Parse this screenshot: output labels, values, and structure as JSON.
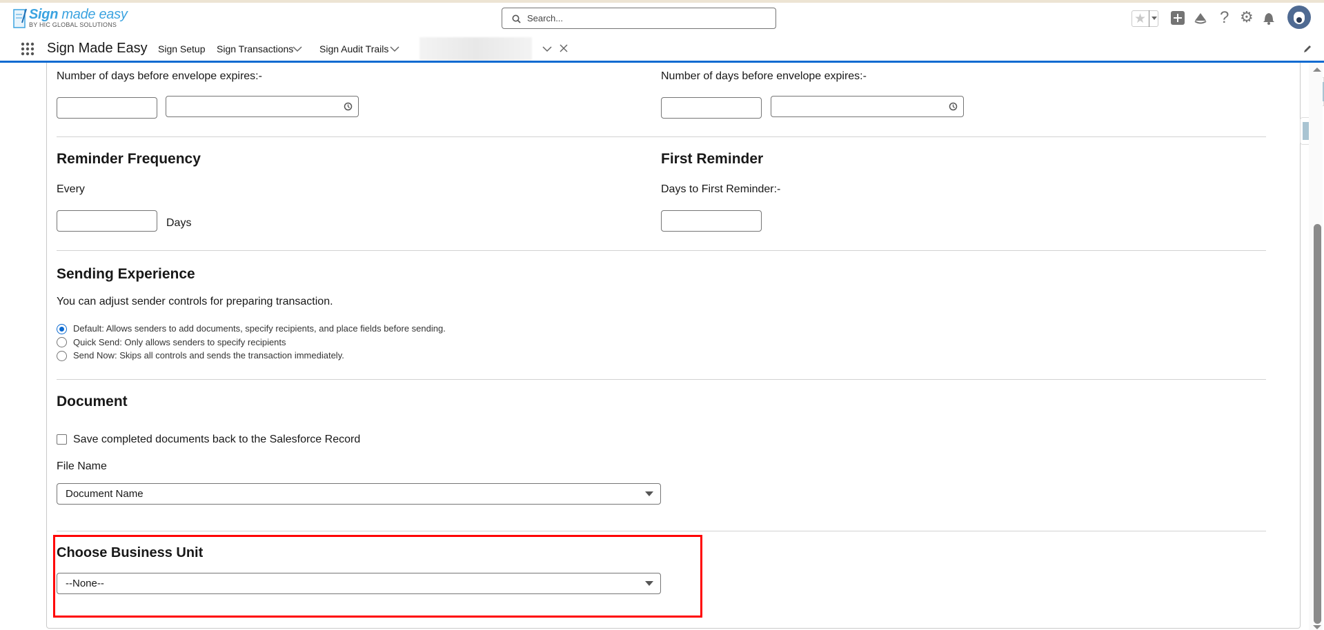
{
  "header": {
    "logo_title_bold": "Sign",
    "logo_title_rest": " made easy",
    "logo_subtitle": "BY HIC GLOBAL SOLUTIONS",
    "search_placeholder": "Search...",
    "icons": [
      "star-icon",
      "chevron-down-icon",
      "plus-icon",
      "trailhead-icon",
      "help-icon",
      "gear-icon",
      "bell-icon",
      "avatar"
    ]
  },
  "nav": {
    "app_name": "Sign Made Easy",
    "items": [
      {
        "label": "Sign Setup"
      },
      {
        "label": "Sign Transactions"
      },
      {
        "label": "Sign Audit Trails"
      }
    ]
  },
  "expiry": {
    "left_label": "Number of days before envelope expires:-",
    "right_label": "Number of days before envelope expires:-"
  },
  "reminder": {
    "heading": "Reminder Frequency",
    "every_label": "Every",
    "days_label": "Days"
  },
  "first_reminder": {
    "heading": "First Reminder",
    "label": "Days to First Reminder:-"
  },
  "sending": {
    "heading": "Sending Experience",
    "description": "You can adjust sender controls for preparing transaction.",
    "options": [
      {
        "label": "Default: Allows senders to add documents, specify recipients, and place fields before sending.",
        "selected": true
      },
      {
        "label": "Quick Send: Only allows senders to specify recipients",
        "selected": false
      },
      {
        "label": "Send Now: Skips all controls and sends the transaction immediately.",
        "selected": false
      }
    ]
  },
  "document": {
    "heading": "Document",
    "checkbox_label": "Save completed documents back to the Salesforce Record",
    "checkbox_checked": false,
    "file_name_label": "File Name",
    "file_name_value": "Document Name"
  },
  "business_unit": {
    "heading": "Choose Business Unit",
    "value": "--None--"
  },
  "colors": {
    "accent": "#0b6ad1",
    "highlight": "#ff0000"
  }
}
